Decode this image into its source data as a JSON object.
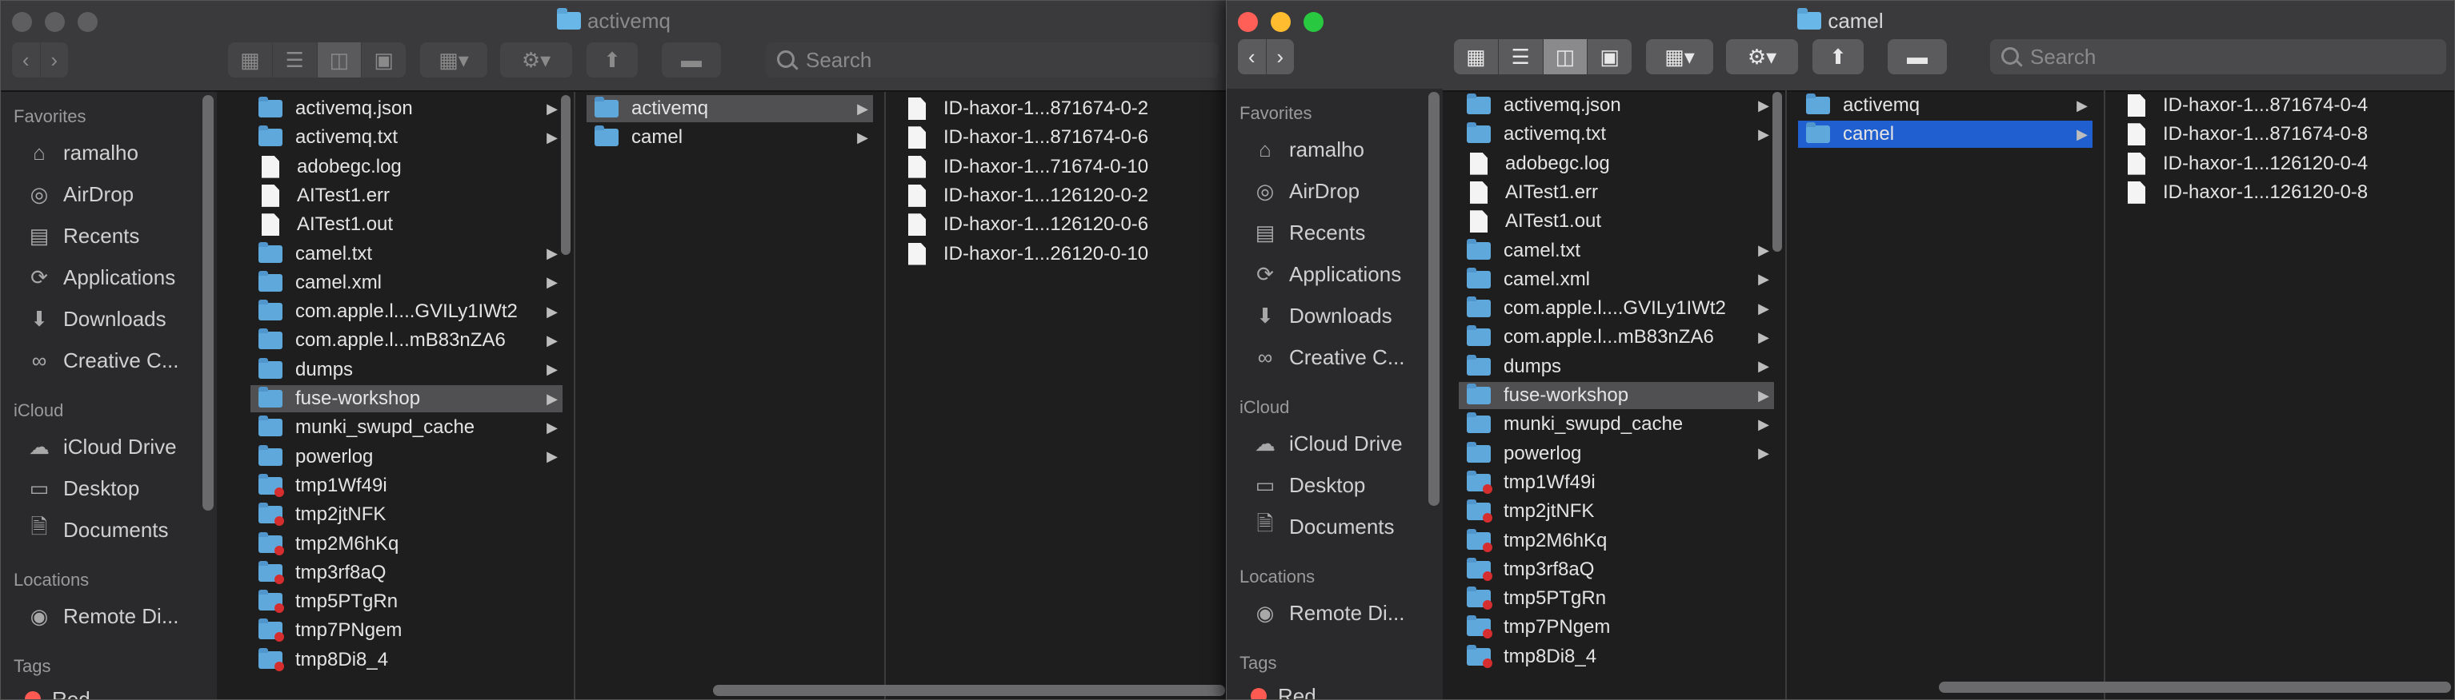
{
  "sidebar_sections": {
    "favorites": "Favorites",
    "icloud": "iCloud",
    "locations": "Locations",
    "tags": "Tags"
  },
  "sidebar_items": {
    "favorites": [
      "ramalho",
      "AirDrop",
      "Recents",
      "Applications",
      "Downloads",
      "Creative C..."
    ],
    "icloud": [
      "iCloud Drive",
      "Desktop",
      "Documents"
    ],
    "locations": [
      "Remote Di..."
    ],
    "tags": [
      "Red"
    ]
  },
  "search_placeholder": "Search",
  "column1_items": [
    "activemq.json",
    "activemq.txt",
    "adobegc.log",
    "AITest1.err",
    "AITest1.out",
    "camel.txt",
    "camel.xml",
    "com.apple.l....GVILy1IWt2",
    "com.apple.l...mB83nZA6",
    "dumps",
    "fuse-workshop",
    "munki_swupd_cache",
    "powerlog",
    "tmp1Wf49i",
    "tmp2jtNFK",
    "tmp2M6hKq",
    "tmp3rf8aQ",
    "tmp5PTgRn",
    "tmp7PNgem",
    "tmp8Di8_4"
  ],
  "column2_items": [
    "activemq",
    "camel"
  ],
  "left_window": {
    "title": "activemq",
    "column3_items": [
      "ID-haxor-1...871674-0-2",
      "ID-haxor-1...871674-0-6",
      "ID-haxor-1...71674-0-10",
      "ID-haxor-1...126120-0-2",
      "ID-haxor-1...126120-0-6",
      "ID-haxor-1...26120-0-10"
    ]
  },
  "right_window": {
    "title": "camel",
    "column3_items": [
      "ID-haxor-1...871674-0-4",
      "ID-haxor-1...871674-0-8",
      "ID-haxor-1...126120-0-4",
      "ID-haxor-1...126120-0-8"
    ]
  },
  "colors": {
    "selection_blue": "#1f5fd0",
    "folder_blue": "#5fa8dc",
    "close_red": "#ff5f57",
    "min_yellow": "#febc2e",
    "max_green": "#28c840"
  },
  "icons": {
    "favorites": [
      "home-icon",
      "airdrop-icon",
      "recents-icon",
      "applications-icon",
      "downloads-icon",
      "creative-cloud-icon"
    ],
    "icloud": [
      "icloud-icon",
      "desktop-icon",
      "documents-icon"
    ],
    "locations": [
      "disk-icon"
    ]
  }
}
